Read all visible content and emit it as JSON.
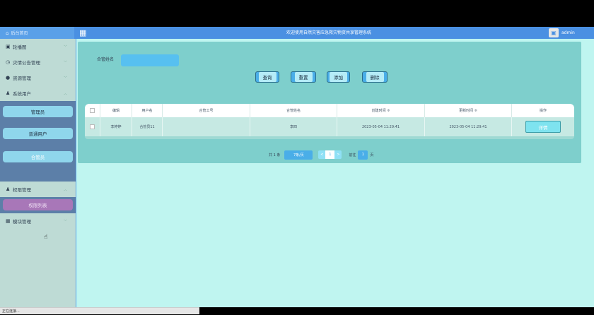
{
  "header": {
    "home_label": "后台首页",
    "title": "欢迎使用自然灾害应急救灾物资共享管理系统",
    "username": "admin"
  },
  "sidebar": {
    "items": [
      {
        "label": "轮播图"
      },
      {
        "label": "灾情公告管理"
      },
      {
        "label": "资源管理"
      },
      {
        "label": "系统用户"
      }
    ],
    "sub_users": [
      "管理员",
      "普通用户",
      "合管员"
    ],
    "perm_group": "权限管理",
    "perm_sub": "权限列表",
    "module_group": "模块管理"
  },
  "search": {
    "label": "合管姓名",
    "value": ""
  },
  "buttons": {
    "query": "查询",
    "reset": "重置",
    "add": "添加",
    "delete": "删除"
  },
  "table": {
    "headers": [
      "编辑",
      "用户名",
      "合管工号",
      "合管姓名",
      "创建时间 ≑",
      "更新时间 ≑",
      "操作"
    ],
    "rows": [
      {
        "c1": "李婷婷",
        "c2": "合管员11",
        "c3": "",
        "c4": "李四",
        "c5": "2023-05-04 11:29:41",
        "c6": "2023-05-04 11:29:41",
        "action": "详情"
      }
    ]
  },
  "pager": {
    "total": "共 1 条",
    "page_size": "7条/页",
    "current": "1",
    "goto": "前往",
    "goto_page": "1",
    "page_unit": "页"
  },
  "status": "正在连接..."
}
